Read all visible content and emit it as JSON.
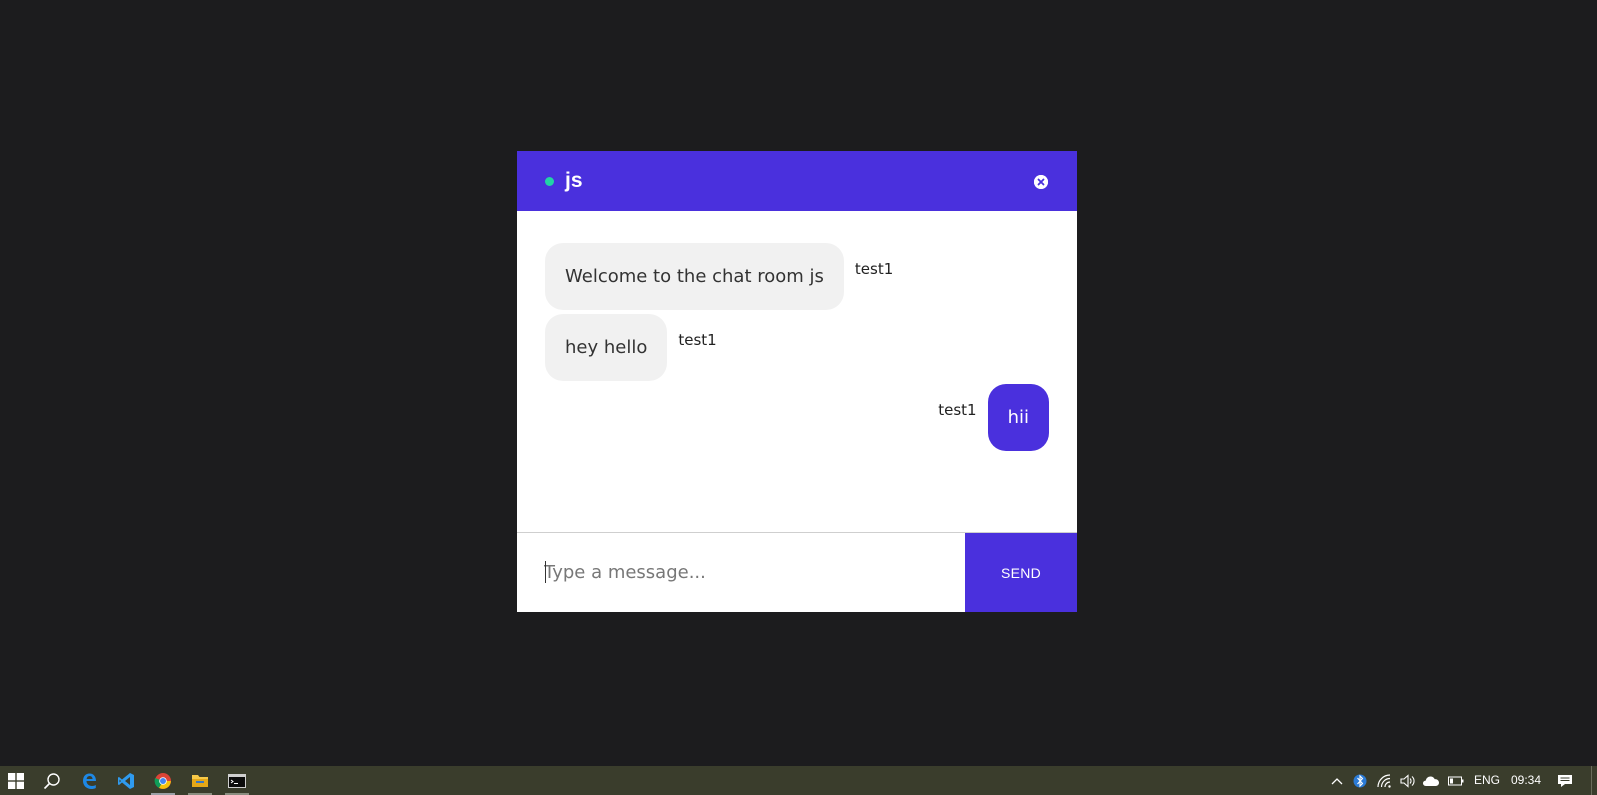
{
  "chat": {
    "room_name": "js",
    "status": "online",
    "status_color": "#22d3a6",
    "accent_color": "#4a30dd",
    "close_icon": "close-circle-icon",
    "messages": [
      {
        "text": "Welcome to the chat room js",
        "sender": "test1",
        "direction": "incoming"
      },
      {
        "text": "hey hello",
        "sender": "test1",
        "direction": "incoming"
      },
      {
        "text": "hii",
        "sender": "test1",
        "direction": "outgoing"
      }
    ],
    "input": {
      "placeholder": "Type a message...",
      "value": ""
    },
    "send_label": "SEND"
  },
  "taskbar": {
    "apps": [
      {
        "name": "start",
        "icon": "windows-icon"
      },
      {
        "name": "search",
        "icon": "search-icon"
      },
      {
        "name": "edge",
        "icon": "edge-icon"
      },
      {
        "name": "vscode",
        "icon": "vscode-icon"
      },
      {
        "name": "chrome",
        "icon": "chrome-icon"
      },
      {
        "name": "file-explorer",
        "icon": "folder-icon"
      },
      {
        "name": "command-prompt",
        "icon": "terminal-icon"
      }
    ],
    "tray": {
      "language": "ENG",
      "time": "09:34"
    }
  }
}
